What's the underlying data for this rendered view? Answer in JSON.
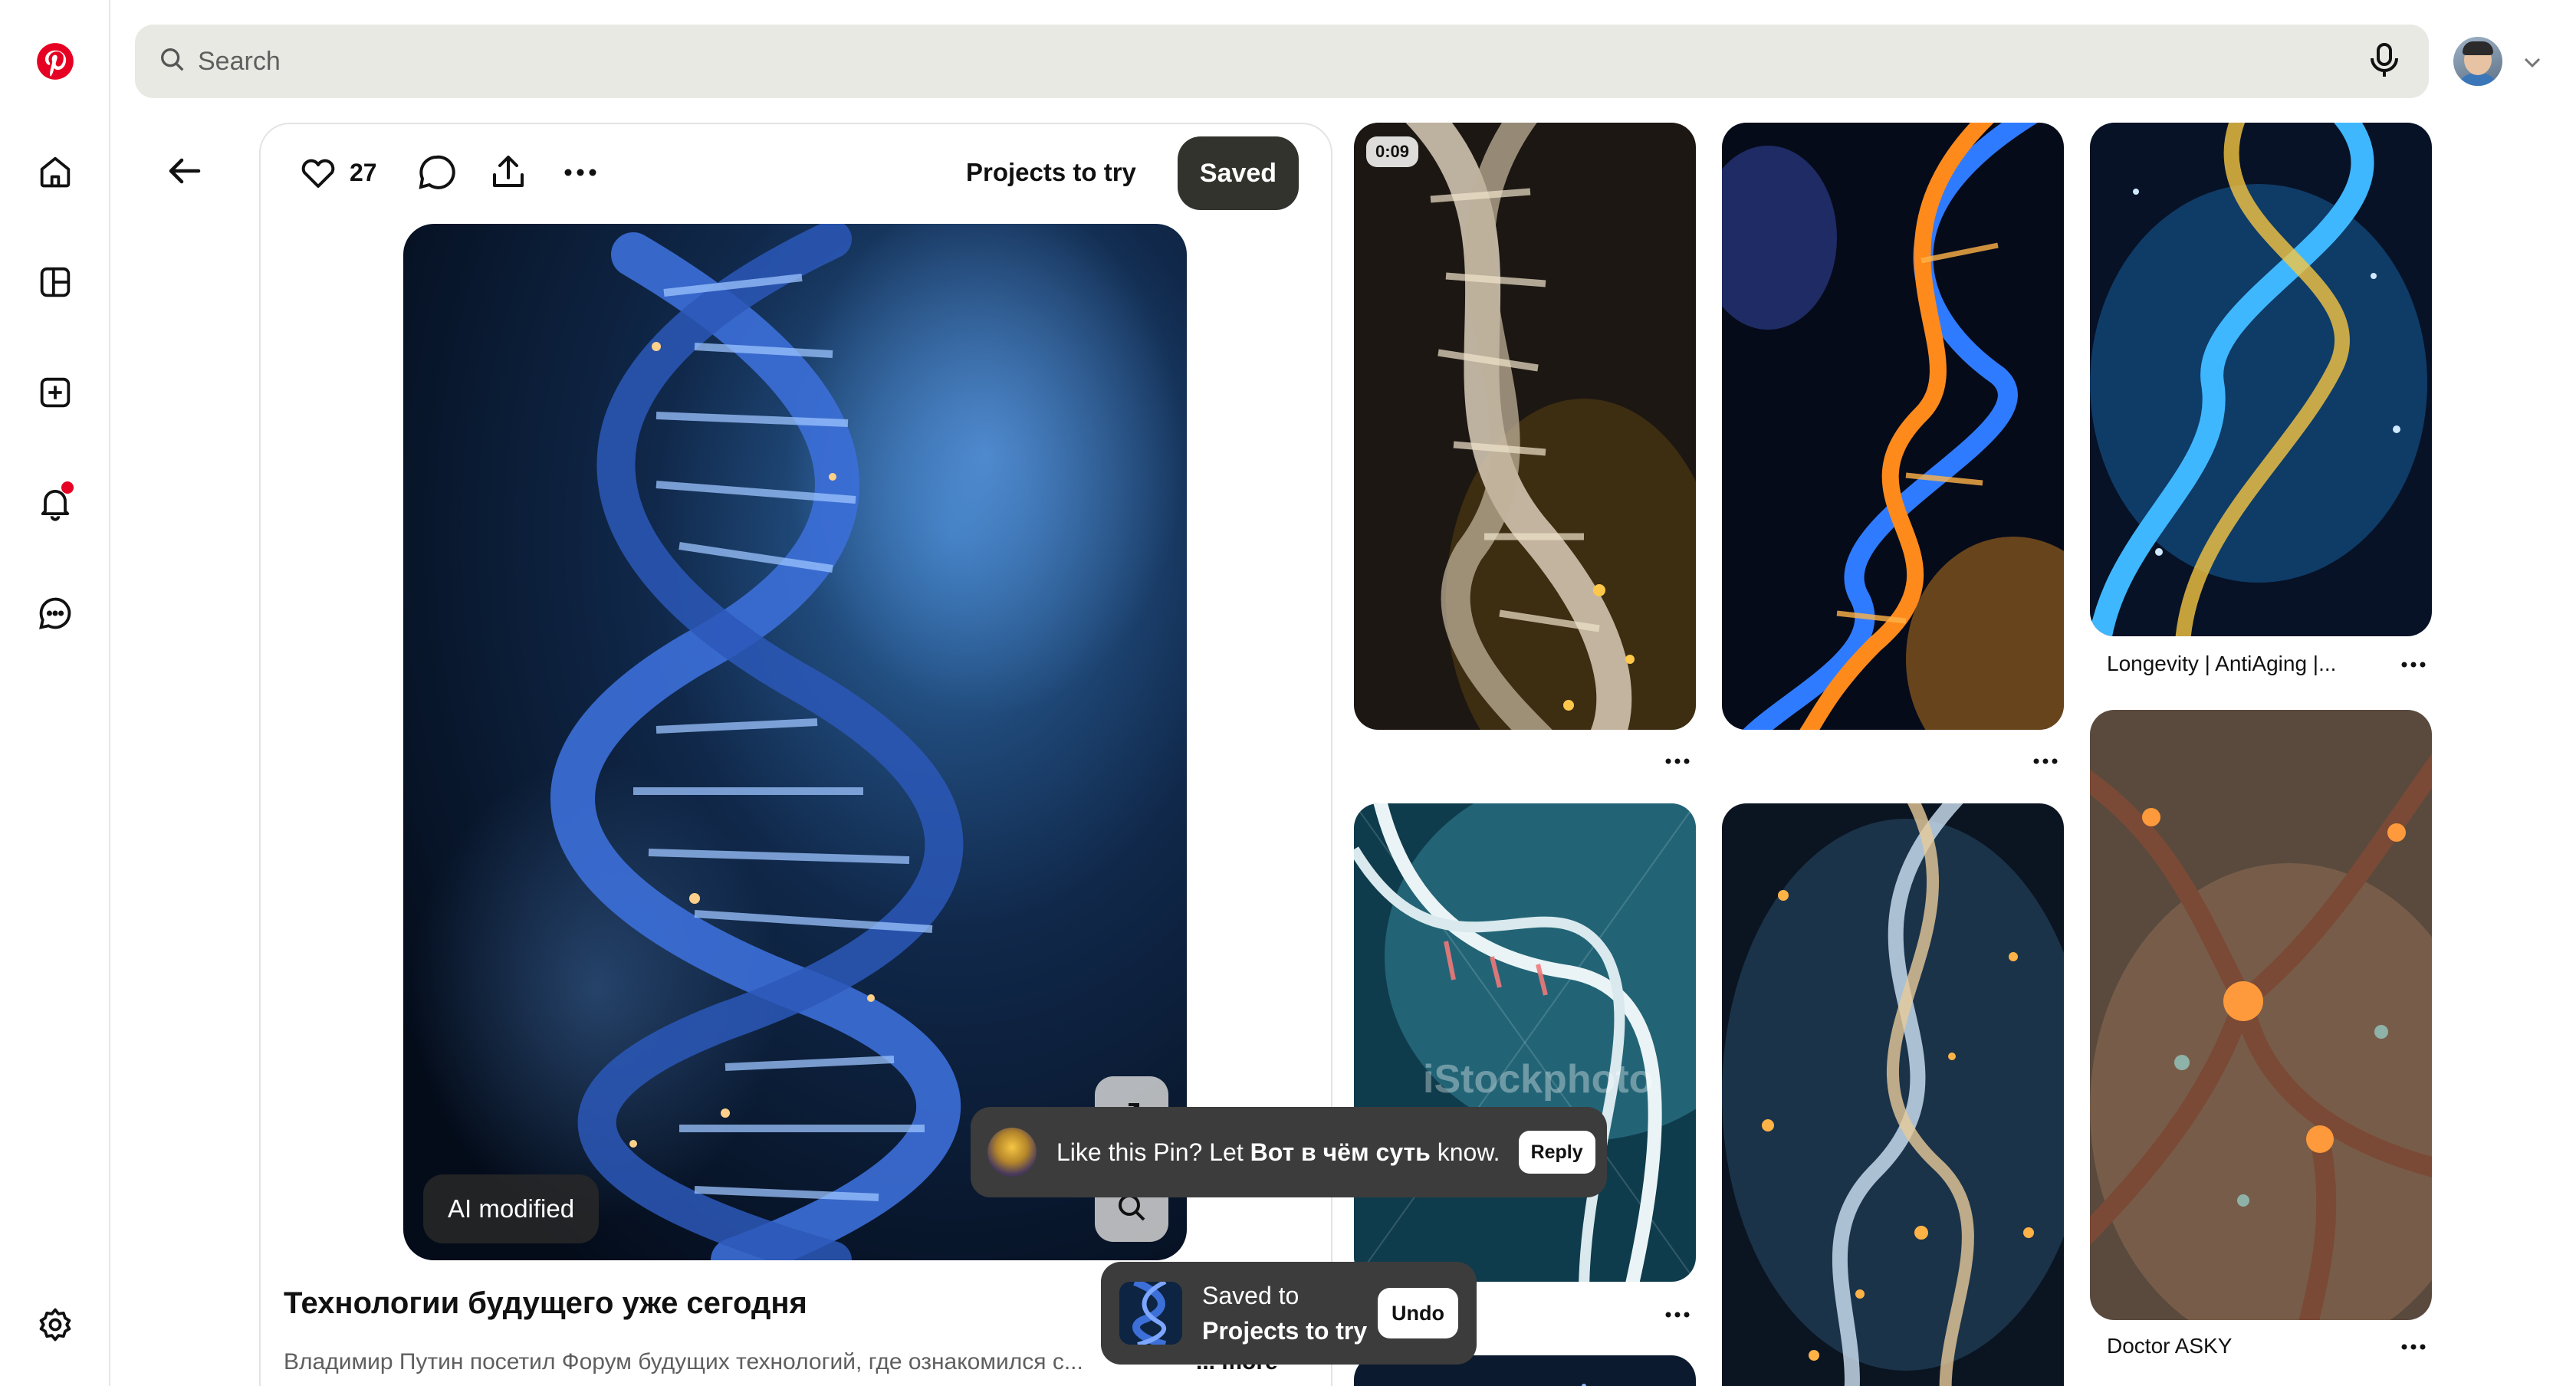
{
  "app": {
    "brand": "Pinterest",
    "brand_color": "#e60023"
  },
  "nav": {
    "items": [
      {
        "name": "pinterest-logo-icon"
      },
      {
        "name": "home-icon"
      },
      {
        "name": "boards-icon"
      },
      {
        "name": "create-icon"
      },
      {
        "name": "notifications-icon"
      },
      {
        "name": "messages-icon"
      },
      {
        "name": "settings-icon"
      }
    ]
  },
  "search": {
    "placeholder": "Search",
    "value": ""
  },
  "pin": {
    "like_count": "27",
    "board": "Projects to try",
    "saved_label": "Saved",
    "ai_badge": "AI modified",
    "title": "Технологии будущего уже сегодня",
    "description": "Владимир Путин посетил Форум будущих технологий, где ознакомился с...",
    "more_label": "... more"
  },
  "toasts": {
    "comment_prompt": {
      "prefix": "Like this Pin? Let ",
      "user": "Вот в чём суть",
      "suffix": " know.",
      "reply_label": "Reply"
    },
    "saved": {
      "line1": "Saved to",
      "line2": "Projects to try",
      "undo_label": "Undo"
    }
  },
  "grid": {
    "pins": [
      {
        "duration": "0:09",
        "label": ""
      },
      {
        "label": ""
      },
      {
        "label": "Longevity | AntiAging |..."
      },
      {
        "label": "",
        "watermark": "iStockphoto"
      },
      {
        "label": ""
      },
      {
        "label": "Doctor ASKY"
      }
    ]
  },
  "colors": {
    "saved_button": "#33332e",
    "toast_bg": "#3c3c3c",
    "search_bg": "#e9e9e4"
  }
}
